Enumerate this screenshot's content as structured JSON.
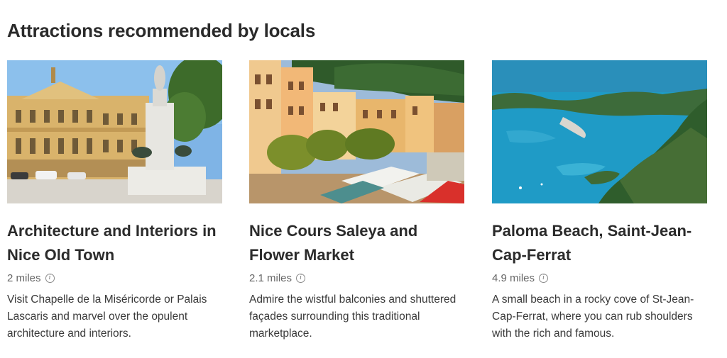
{
  "section": {
    "title": "Attractions recommended by locals"
  },
  "cards": [
    {
      "title": "Architecture and Interiors in Nice Old Town",
      "distance": "2 miles",
      "description": "Visit Chapelle de la Miséricorde or Palais Lascaris and marvel over the opulent architecture and interiors.",
      "image": "old-town-square-statue"
    },
    {
      "title": "Nice Cours Saleya and Flower Market",
      "distance": "2.1 miles",
      "description": "Admire the wistful balconies and shuttered façades surrounding this traditional marketplace.",
      "image": "market-street-colorful-buildings"
    },
    {
      "title": "Paloma Beach, Saint-Jean-Cap-Ferrat",
      "distance": "4.9 miles",
      "description": "A small beach in a rocky cove of St-Jean-Cap-Ferrat, where you can rub shoulders with the rich and famous.",
      "image": "aerial-coastline-turquoise-sea"
    }
  ],
  "icons": {
    "info": "info-icon"
  },
  "colors": {
    "title": "#2a2a2a",
    "meta": "#666666",
    "body": "#3a3a3a",
    "background": "#ffffff"
  }
}
